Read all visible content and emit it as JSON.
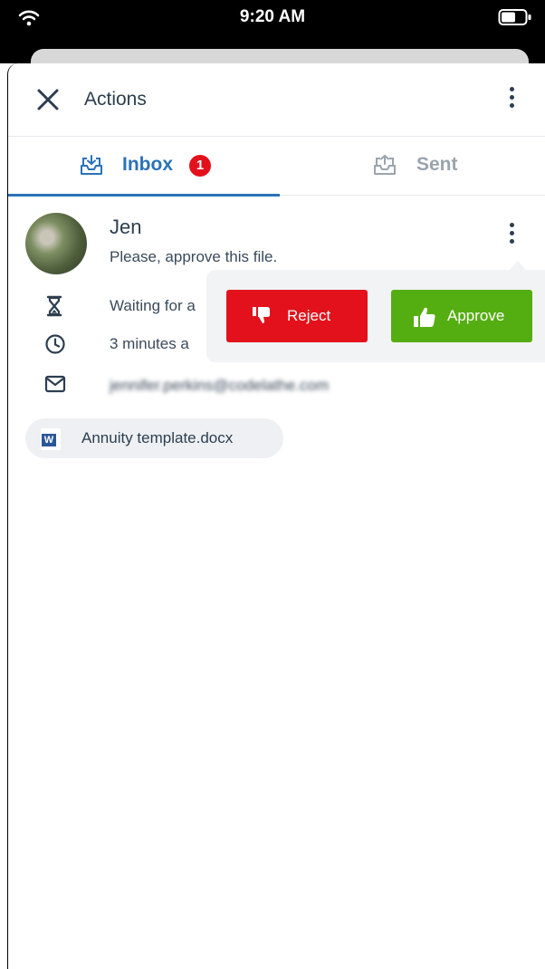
{
  "status_bar": {
    "time": "9:20 AM"
  },
  "header": {
    "title": "Actions"
  },
  "tabs": [
    {
      "label": "Inbox",
      "badge": "1",
      "active": true
    },
    {
      "label": "Sent",
      "active": false
    }
  ],
  "item": {
    "sender": "Jen",
    "message": "Please, approve this file.",
    "status": "Waiting for a",
    "time": "3 minutes a",
    "email": "jennifer.perkins@codelathe.com",
    "file": {
      "name": "Annuity template.docx",
      "type_letter": "W"
    }
  },
  "actions": {
    "reject_label": "Reject",
    "approve_label": "Approve"
  },
  "colors": {
    "accent": "#2a73b8",
    "reject": "#e3111b",
    "approve": "#55ae11",
    "badge": "#e3111b"
  }
}
